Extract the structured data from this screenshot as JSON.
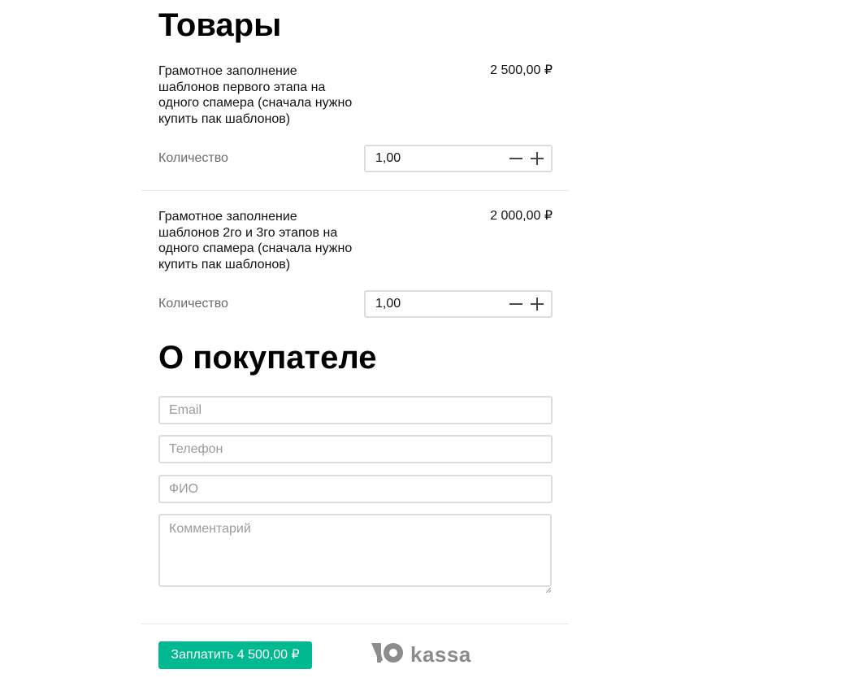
{
  "sections": {
    "products_title": "Товары",
    "buyer_title": "О покупателе"
  },
  "products": [
    {
      "name": "Грамотное заполнение шаблонов первого этапа на одного спамера (сначала нужно купить пак шаблонов)",
      "price": "2 500,00 ₽",
      "quantity_label": "Количество",
      "quantity": "1,00"
    },
    {
      "name": "Грамотное заполнение шаблонов 2го и 3го этапов на одного спамера (сначала нужно купить пак шаблонов)",
      "price": "2 000,00 ₽",
      "quantity_label": "Количество",
      "quantity": "1,00"
    }
  ],
  "form": {
    "email_placeholder": "Email",
    "phone_placeholder": "Телефон",
    "name_placeholder": "ФИО",
    "comment_placeholder": "Комментарий"
  },
  "footer": {
    "pay_label": "Заплатить 4 500,00 ₽",
    "logo_text": "kassa"
  },
  "colors": {
    "accent": "#00b991",
    "border": "#dcdcdc",
    "muted_text": "#6b6b6b",
    "logo": "#8c8c8c"
  },
  "icons": {
    "minus": "minus-icon",
    "plus": "plus-icon",
    "logo": "yoomoney-logo-icon"
  }
}
